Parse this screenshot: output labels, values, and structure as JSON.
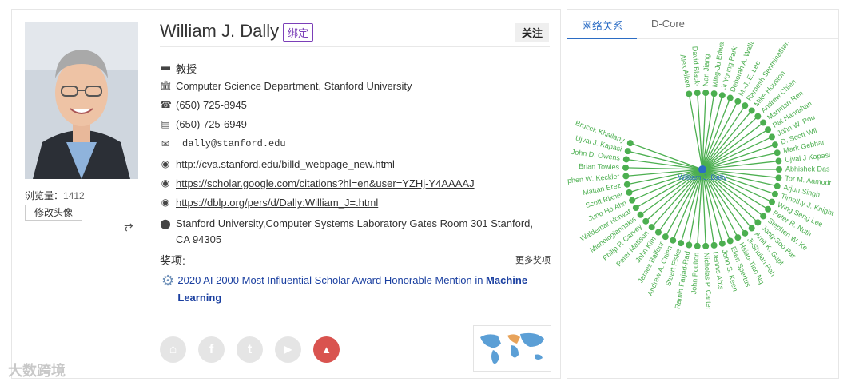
{
  "profile": {
    "name": "William J. Dally",
    "bind_badge": "绑定",
    "follow_label": "关注",
    "views_label": "浏览量：",
    "views_count": "1412",
    "change_avatar_label": "修改头像",
    "position": "教授",
    "affiliation": "Computer Science Department, Stanford University",
    "phone": "(650) 725-8945",
    "fax": "(650) 725-6949",
    "email": "dally@stanford.edu",
    "links": [
      "http://cva.stanford.edu/billd_webpage_new.html",
      "https://scholar.google.com/citations?hl=en&user=YZHj-Y4AAAAJ",
      "https://dblp.org/pers/d/Dally:William_J=.html"
    ],
    "address_line1": "Stanford University,Computer Systems Laboratory Gates Room 301 Stanford,",
    "address_line2": "CA 94305"
  },
  "awards": {
    "label": "奖项:",
    "more_label": "更多奖项",
    "items": [
      {
        "text": "2020 AI 2000 Most Influential Scholar Award Honorable Mention in ",
        "field": "Machine Learning"
      }
    ]
  },
  "social": [
    {
      "icon": "home-icon",
      "color": "#e5e5e5",
      "glyph": "⌂"
    },
    {
      "icon": "facebook-icon",
      "color": "#e5e5e5",
      "glyph": "f"
    },
    {
      "icon": "twitter-icon",
      "color": "#e5e5e5",
      "glyph": "t"
    },
    {
      "icon": "youtube-icon",
      "color": "#e5e5e5",
      "glyph": "▶"
    },
    {
      "icon": "graduation-cap-icon",
      "color": "#d9534f",
      "glyph": "🎓"
    }
  ],
  "watermark": "大数跨境",
  "network_panel": {
    "tabs": [
      "网络关系",
      "D-Core"
    ],
    "center_label": "William J. Dally",
    "edge_color": "#4caf50",
    "center_color": "#2b6cc4",
    "nodes": [
      "Alex Aiken",
      "David Black-",
      "Nan Jiang",
      "Ming-Ju Edwar",
      "Ji Young Park",
      "Deborah A. Wallach",
      "M.-J. E. Lee",
      "Ramesh Senthinathan",
      "Mike Houston",
      "Andrew Chien",
      "Manman Ren",
      "Pat Hanrahan",
      "John W. Pou",
      "D. Scott Wil",
      "Mark Gebhar",
      "Ujval J Kapasi",
      "Abhishek Das",
      "Tor M. Aamodt",
      "Arjun Singh",
      "Timothy J. Knight",
      "Wing Seng Lee",
      "Peter R. Nuth",
      "Stephen W. Ke",
      "Jong-Soo Par",
      "Amit K. Gupt",
      "Ji-Shuian Peh",
      "Hsiao-Tiao Ng",
      "Ellen Spertus",
      "John S. Keen",
      "Dennis Abts",
      "Nicholas P. Carter",
      "John Poulton",
      "Ramin Farjad-Rad",
      "Stuart Fiske",
      "Andrew A. Chien",
      "James Balfour",
      "John Kim",
      "Peter Mattson",
      "Philip P. Carvey",
      "Michelogiannakis",
      "Waldemar Horwat",
      "Jung Ho Ahn",
      "Scott Rixner",
      "Mattan Erez",
      "Stephen W. Keckler",
      "Brian Towles",
      "John D. Owens",
      "Ujval J. Kapasi",
      "Brucek Khailany"
    ]
  }
}
